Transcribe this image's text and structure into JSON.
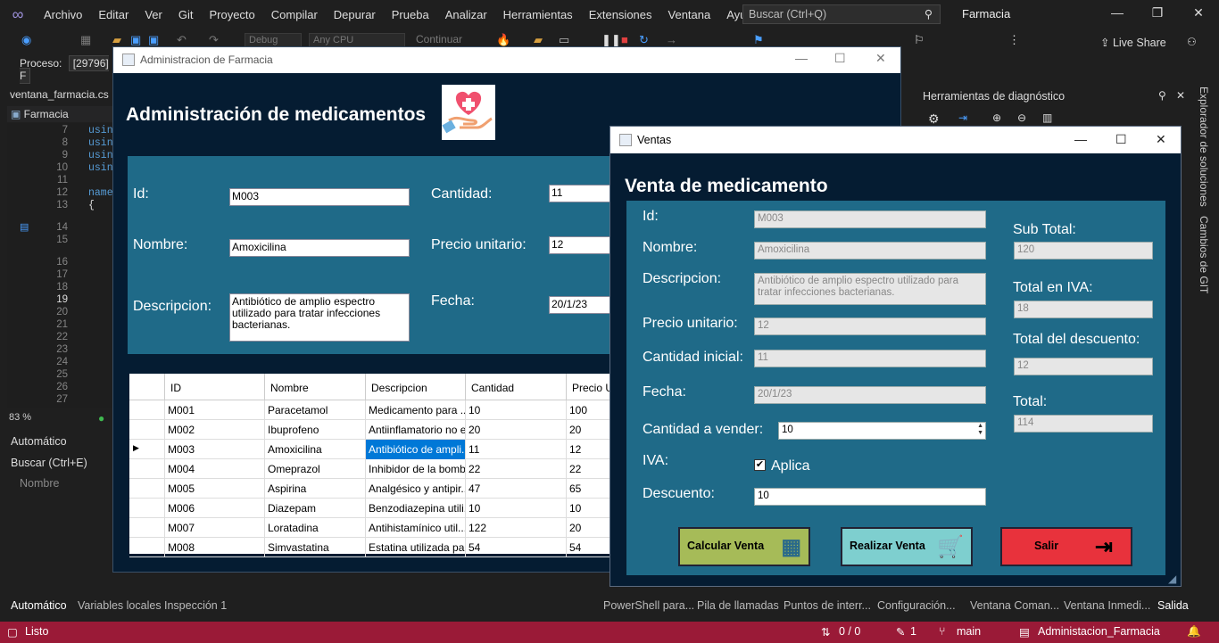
{
  "vs": {
    "menu": [
      "Archivo",
      "Editar",
      "Ver",
      "Git",
      "Proyecto",
      "Compilar",
      "Depurar",
      "Prueba",
      "Analizar",
      "Herramientas",
      "Extensiones",
      "Ventana",
      "Ayuda"
    ],
    "search_placeholder": "Buscar (Ctrl+Q)",
    "solution_title": "Farmacia",
    "toolbar": {
      "config": "Debug",
      "platform": "Any CPU",
      "continue_label": "Continuar",
      "liveshare": "Live Share"
    },
    "process_label": "Proceso:",
    "process_value": "[29796] F",
    "editor": {
      "file_tab": "ventana_farmacia.cs",
      "nav_scope": "Farmacia",
      "line_numbers": [
        "7",
        "8",
        "9",
        "10",
        "11",
        "12",
        "13",
        "14",
        "15",
        "16",
        "17",
        "18",
        "19",
        "20",
        "21",
        "22",
        "23",
        "24",
        "25",
        "26",
        "27"
      ],
      "code_snippets": [
        "usin",
        "usin",
        "usin",
        "usin",
        "name",
        "{"
      ],
      "zoom": "83 %"
    },
    "autos_panel": {
      "title": "Automático",
      "search": "Buscar (Ctrl+E)",
      "column": "Nombre"
    },
    "diagnostics_title": "Herramientas de diagnóstico",
    "vertical_tabs": [
      "Explorador de soluciones",
      "Cambios de GIT"
    ],
    "bottom_tabs_left": [
      "Automático",
      "Variables locales",
      "Inspección 1"
    ],
    "bottom_tabs_right": [
      "PowerShell para...",
      "Pila de llamadas",
      "Puntos de interr...",
      "Configuración...",
      "Ventana Coman...",
      "Ventana Inmedi...",
      "Salida"
    ],
    "status": {
      "ready": "Listo",
      "changes": "0 / 0",
      "commits": "1",
      "branch": "main",
      "project": "Administacion_Farmacia"
    }
  },
  "farmacia": {
    "window_title": "Administracion de Farmacia",
    "heading": "Administración de medicamentos",
    "form": {
      "id_label": "Id:",
      "id_value": "M003",
      "nombre_label": "Nombre:",
      "nombre_value": "Amoxicilina",
      "descripcion_label": "Descripcion:",
      "descripcion_value": "Antibiótico de amplio espectro utilizado para tratar infecciones bacterianas.",
      "cantidad_label": "Cantidad:",
      "cantidad_value": "11",
      "precio_label": "Precio unitario:",
      "precio_value": "12",
      "fecha_label": "Fecha:",
      "fecha_value": "20/1/23"
    },
    "grid": {
      "headers": [
        "ID",
        "Nombre",
        "Descripcion",
        "Cantidad",
        "Precio Ur"
      ],
      "selected_row": 2,
      "rows": [
        [
          "M001",
          "Paracetamol",
          "Medicamento para ...",
          "10",
          "100"
        ],
        [
          "M002",
          "Ibuprofeno",
          "Antiinflamatorio no e...",
          "20",
          "20"
        ],
        [
          "M003",
          "Amoxicilina",
          "Antibiótico de ampli...",
          "11",
          "12"
        ],
        [
          "M004",
          "Omeprazol",
          "Inhibidor de la bomb...",
          "22",
          "22"
        ],
        [
          "M005",
          "Aspirina",
          "Analgésico y antipir...",
          "47",
          "65"
        ],
        [
          "M006",
          "Diazepam",
          "Benzodiazepina utili...",
          "10",
          "10"
        ],
        [
          "M007",
          "Loratadina",
          "Antihistamínico util...",
          "122",
          "20"
        ],
        [
          "M008",
          "Simvastatina",
          "Estatina utilizada pa...",
          "54",
          "54"
        ]
      ]
    }
  },
  "ventas": {
    "window_title": "Ventas",
    "heading": "Venta de medicamento",
    "id_label": "Id:",
    "id_value": "M003",
    "nombre_label": "Nombre:",
    "nombre_value": "Amoxicilina",
    "descripcion_label": "Descripcion:",
    "descripcion_value": "Antibiótico de amplio espectro utilizado para tratar infecciones bacterianas.",
    "precio_label": "Precio unitario:",
    "precio_value": "12",
    "cantidad_inicial_label": "Cantidad inicial:",
    "cantidad_inicial_value": "11",
    "fecha_label": "Fecha:",
    "fecha_value": "20/1/23",
    "cantidad_vender_label": "Cantidad a vender:",
    "cantidad_vender_value": "10",
    "iva_label": "IVA:",
    "iva_checkbox_label": "Aplica",
    "descuento_label": "Descuento:",
    "descuento_value": "10",
    "subtotal_label": "Sub Total:",
    "subtotal_value": "120",
    "total_iva_label": "Total en IVA:",
    "total_iva_value": "18",
    "total_descuento_label": "Total del descuento:",
    "total_descuento_value": "12",
    "total_label": "Total:",
    "total_value": "114",
    "buttons": {
      "calcular": "Calcular Venta",
      "realizar": "Realizar Venta",
      "salir": "Salir"
    },
    "colors": {
      "calcular": "#a6bb58",
      "realizar": "#7ecfcf",
      "salir": "#e8323c",
      "panel": "#1f6a88",
      "background": "#051c32"
    }
  }
}
